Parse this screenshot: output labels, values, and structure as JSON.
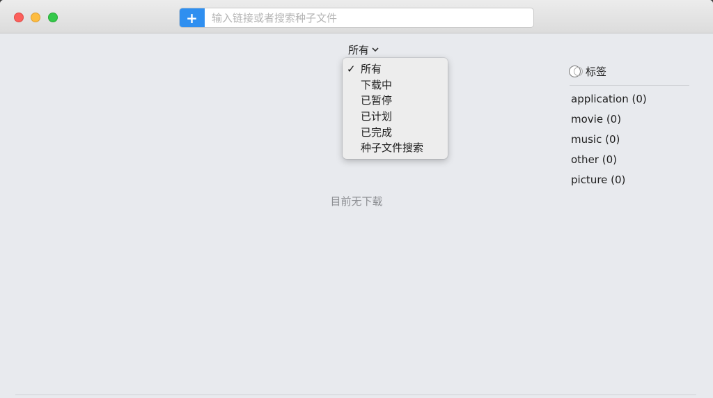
{
  "search": {
    "add_label": "+",
    "placeholder": "输入链接或者搜索种子文件",
    "value": ""
  },
  "filter": {
    "selected": "所有",
    "chevron": "⌄",
    "options": [
      {
        "label": "所有",
        "checked": true
      },
      {
        "label": "下载中",
        "checked": false
      },
      {
        "label": "已暂停",
        "checked": false
      },
      {
        "label": "已计划",
        "checked": false
      },
      {
        "label": "已完成",
        "checked": false
      },
      {
        "label": "种子文件搜索",
        "checked": false
      }
    ],
    "check_mark": "✓"
  },
  "main": {
    "empty_message": "目前无下载"
  },
  "tags": {
    "title": "标签",
    "icon": "tags-icon",
    "items": [
      {
        "label": "application (0)"
      },
      {
        "label": "movie (0)"
      },
      {
        "label": "music (0)"
      },
      {
        "label": "other (0)"
      },
      {
        "label": "picture (0)"
      }
    ]
  },
  "colors": {
    "accent": "#2f8ff0",
    "close": "#fc605c",
    "minimize": "#fdbc40",
    "maximize": "#34c84a",
    "background": "#e8eaee"
  }
}
